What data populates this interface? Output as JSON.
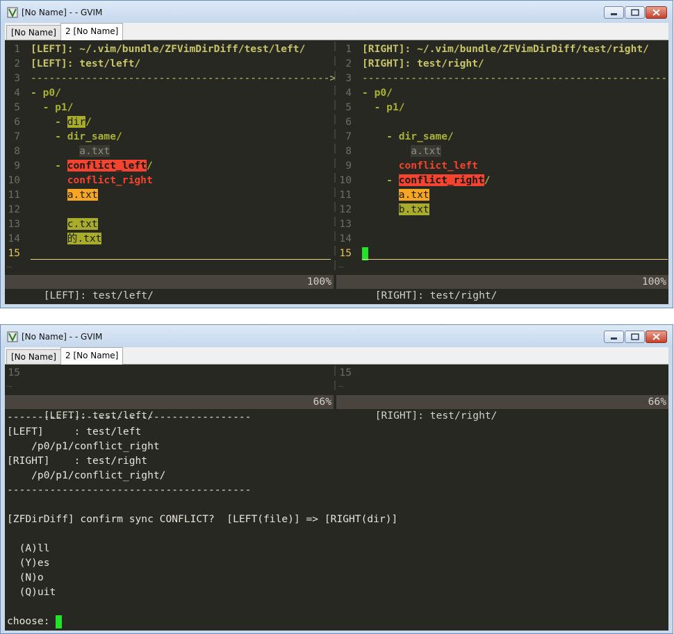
{
  "window1": {
    "title": "[No Name] - - GVIM",
    "tabs": [
      "[No Name]",
      "2 [No Name]"
    ],
    "left": {
      "lines": [
        {
          "n": "1",
          "t": "[LEFT]: ~/.vim/bundle/ZFVimDirDiff/test/left/"
        },
        {
          "n": "2",
          "t": "[LEFT]: test/left/"
        },
        {
          "n": "3",
          "t": "------------------------------------------------->"
        },
        {
          "n": "4",
          "pre": "- ",
          "t": "p0/"
        },
        {
          "n": "5",
          "pre": "  - ",
          "t": "p1/"
        },
        {
          "n": "6",
          "pre": "    - ",
          "t": "dir",
          "post": "/"
        },
        {
          "n": "7",
          "pre": "    - ",
          "t": "dir_same/"
        },
        {
          "n": "8",
          "pre": "        ",
          "t": "a.txt"
        },
        {
          "n": "9",
          "pre": "    - ",
          "t": "conflict_left",
          "post": "/"
        },
        {
          "n": "10",
          "pre": "      ",
          "t": "conflict_right"
        },
        {
          "n": "11",
          "pre": "      ",
          "t": "a.txt"
        },
        {
          "n": "12",
          "t": ""
        },
        {
          "n": "13",
          "pre": "      ",
          "t": "c.txt"
        },
        {
          "n": "14",
          "pre": "      ",
          "t": "的.txt"
        },
        {
          "n": "15",
          "t": ""
        }
      ],
      "tilde": "~",
      "status": "[LEFT]: test/left/",
      "percent": "100%"
    },
    "right": {
      "lines": [
        {
          "n": "1",
          "t": "[RIGHT]: ~/.vim/bundle/ZFVimDirDiff/test/right/"
        },
        {
          "n": "2",
          "t": "[RIGHT]: test/right/"
        },
        {
          "n": "3",
          "t": "--------------------------------------------------"
        },
        {
          "n": "4",
          "pre": "- ",
          "t": "p0/"
        },
        {
          "n": "5",
          "pre": "  - ",
          "t": "p1/"
        },
        {
          "n": "6",
          "t": ""
        },
        {
          "n": "7",
          "pre": "    - ",
          "t": "dir_same/"
        },
        {
          "n": "8",
          "pre": "        ",
          "t": "a.txt"
        },
        {
          "n": "9",
          "pre": "      ",
          "t": "conflict_left"
        },
        {
          "n": "10",
          "pre": "    - ",
          "t": "conflict_right",
          "post": "/"
        },
        {
          "n": "11",
          "pre": "      ",
          "t": "a.txt"
        },
        {
          "n": "12",
          "pre": "      ",
          "t": "b.txt"
        },
        {
          "n": "13",
          "t": ""
        },
        {
          "n": "14",
          "t": ""
        },
        {
          "n": "15",
          "t": ""
        }
      ],
      "tilde": "~",
      "status": "[RIGHT]: test/right/",
      "percent": "100%"
    }
  },
  "window2": {
    "title": "[No Name] - - GVIM",
    "tabs": [
      "[No Name]",
      "2 [No Name]"
    ],
    "left_line": "15",
    "right_line": "15",
    "tilde": "~",
    "left_status": "[LEFT]: test/left/",
    "left_percent": "66%",
    "right_status": "[RIGHT]: test/right/",
    "right_percent": "66%",
    "cmd_lines": [
      "----------------------------------------",
      "[LEFT]     : test/left",
      "    /p0/p1/conflict_right",
      "[RIGHT]    : test/right",
      "    /p0/p1/conflict_right/",
      "----------------------------------------",
      "",
      "[ZFDirDiff] confirm sync CONFLICT?  [LEFT(file)] => [RIGHT(dir)]",
      "",
      "  (A)ll",
      "  (Y)es",
      "  (N)o",
      "  (Q)uit",
      ""
    ],
    "prompt": "choose: "
  }
}
